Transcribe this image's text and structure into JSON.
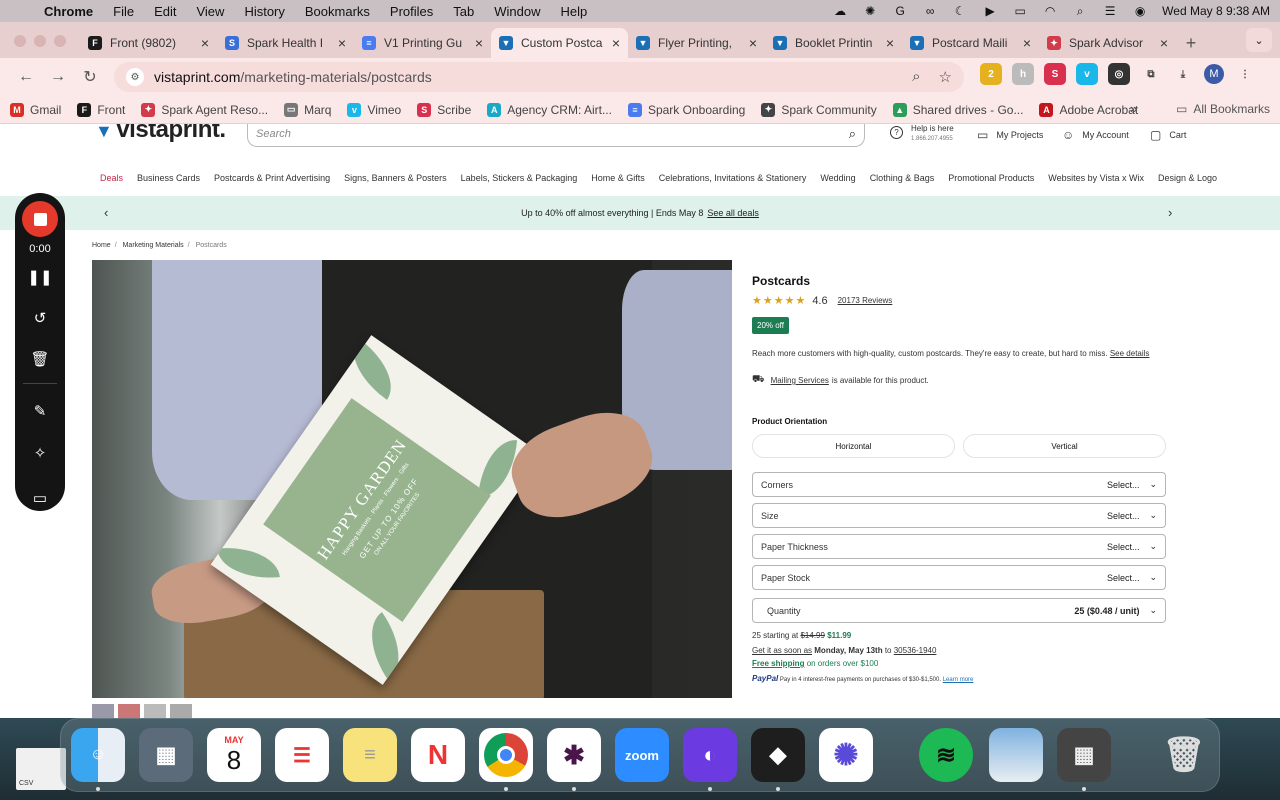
{
  "menubar": {
    "app": "Chrome",
    "items": [
      "File",
      "Edit",
      "View",
      "History",
      "Bookmarks",
      "Profiles",
      "Tab",
      "Window",
      "Help"
    ],
    "datetime": "Wed May 8  9:38 AM"
  },
  "tabs": [
    {
      "label": "Front (9802)",
      "color": "#1a1a1a",
      "glyph": "F"
    },
    {
      "label": "Spark Health I",
      "color": "#3b6fd8",
      "glyph": "S"
    },
    {
      "label": "V1 Printing Gu",
      "color": "#4a7cf0",
      "glyph": "≡"
    },
    {
      "label": "Custom Postca",
      "color": "#1c6fb5",
      "glyph": "▼",
      "active": true
    },
    {
      "label": "Flyer Printing,",
      "color": "#1c6fb5",
      "glyph": "▼"
    },
    {
      "label": "Booklet Printin",
      "color": "#1c6fb5",
      "glyph": "▼"
    },
    {
      "label": "Postcard Maili",
      "color": "#1c6fb5",
      "glyph": "▼"
    },
    {
      "label": "Spark Advisor",
      "color": "#d23b4c",
      "glyph": "✦"
    }
  ],
  "address": {
    "host": "vistaprint.com",
    "path": "/marketing-materials/postcards"
  },
  "bookmarks": [
    {
      "label": "Gmail",
      "color": "#d93025",
      "glyph": "M"
    },
    {
      "label": "Front",
      "color": "#1a1a1a",
      "glyph": "F"
    },
    {
      "label": "Spark Agent Reso...",
      "color": "#d23b4c",
      "glyph": "✦"
    },
    {
      "label": "Marq",
      "color": "#777777",
      "glyph": "▭"
    },
    {
      "label": "Vimeo",
      "color": "#1ab7ea",
      "glyph": "v"
    },
    {
      "label": "Scribe",
      "color": "#d9304f",
      "glyph": "S"
    },
    {
      "label": "Agency CRM: Airt...",
      "color": "#18a9c9",
      "glyph": "A"
    },
    {
      "label": "Spark Onboarding",
      "color": "#4a7cf0",
      "glyph": "≡"
    },
    {
      "label": "Spark Community",
      "color": "#444444",
      "glyph": "✦"
    },
    {
      "label": "Shared drives - Go...",
      "color": "#2d9d5a",
      "glyph": "▲"
    },
    {
      "label": "Adobe Acrobat",
      "color": "#c4161c",
      "glyph": "A"
    }
  ],
  "bookmarks_all": "All Bookmarks",
  "site": {
    "search_placeholder": "Search",
    "help": "Help is here",
    "phone": "1.866.207.4955",
    "my_projects": "My Projects",
    "my_account": "My Account",
    "cart": "Cart",
    "nav": [
      "Deals",
      "Business Cards",
      "Postcards & Print Advertising",
      "Signs, Banners & Posters",
      "Labels, Stickers & Packaging",
      "Home & Gifts",
      "Celebrations, Invitations & Stationery",
      "Wedding",
      "Clothing & Bags",
      "Promotional Products",
      "Websites by Vista x Wix",
      "Design & Logo"
    ],
    "promo": "Up to 40% off almost everything | Ends May 8",
    "promo_link": "See all deals",
    "breadcrumb": [
      "Home",
      "Marketing Materials",
      "Postcards"
    ]
  },
  "hero_card": {
    "title": "HAPPY GARDEN",
    "subtitle": "Hanging Baskets · Plants · Flowers · Gifts",
    "offer": "GET UP TO 10% OFF",
    "offer_sub": "ON ALL YOUR FAVORITES"
  },
  "product": {
    "title": "Postcards",
    "stars": "★★★★★",
    "rating": "4.6",
    "reviews": "20173 Reviews",
    "badge": "20% off",
    "description": "Reach more customers with high-quality, custom postcards. They're easy to create, but hard to miss.",
    "see_details": "See details",
    "mailing_link": "Mailing Services",
    "mailing_text": "is available for this product.",
    "orientation_label": "Product Orientation",
    "orientations": [
      "Horizontal",
      "Vertical"
    ],
    "options": [
      {
        "label": "Corners",
        "value": "Select..."
      },
      {
        "label": "Size",
        "value": "Select..."
      },
      {
        "label": "Paper Thickness",
        "value": "Select..."
      },
      {
        "label": "Paper Stock",
        "value": "Select..."
      }
    ],
    "quantity_label": "Quantity",
    "quantity_value": "25 ($0.48 / unit)",
    "price_prefix": "25 starting at",
    "price_old": "$14.99",
    "price_new": "$11.99",
    "delivery_prefix": "Get it as soon as",
    "delivery_date": "Monday, May 13th",
    "delivery_to": "to",
    "delivery_zip": "30536-1940",
    "free_shipping": "Free shipping",
    "free_shipping_suffix": "on orders over $100",
    "paypal_brand": "PayPal",
    "paypal_text": "Pay in 4 interest-free payments on purchases of $30-$1,500.",
    "paypal_link": "Learn more"
  },
  "recorder": {
    "time": "0:00"
  },
  "dock": {
    "calendar_month": "MAY",
    "calendar_day": "8",
    "zoom_label": "zoom",
    "desktop_file": "CSV"
  },
  "colors": {
    "accent": "#1c6fb5",
    "deals": "#c4284a",
    "green": "#1d7d52",
    "tabbar": "#e8cfcf"
  }
}
